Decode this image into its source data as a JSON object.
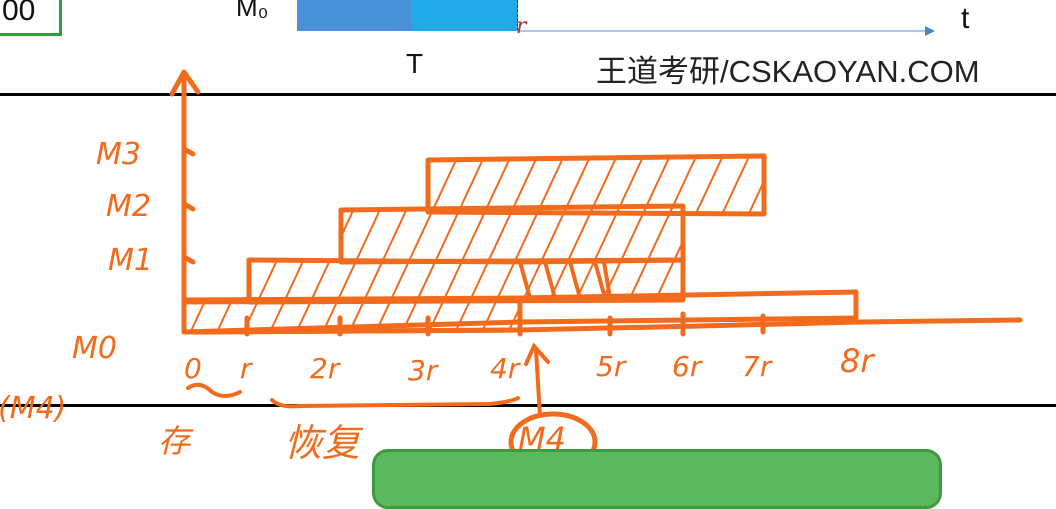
{
  "slide_top": {
    "corner_value": "00",
    "mo_label": "M₀",
    "t_label": "t",
    "T_label": "T",
    "r_label": "r",
    "watermark": "王道考研/CSKAOYAN.COM"
  },
  "diagram": {
    "row_labels": [
      "M3",
      "M2",
      "M1",
      "M0",
      "(M4)"
    ],
    "x_ticks": [
      "0",
      "r",
      "2r",
      "3r",
      "4r",
      "5r",
      "6r",
      "7r",
      "8r"
    ],
    "below_labels": [
      "存",
      "恢复",
      "M4"
    ]
  },
  "colors": {
    "ink": "#f26a1b",
    "bar_dark": "#4a90d9",
    "bar_light": "#21a8e8",
    "button_green": "#5cb85c"
  }
}
